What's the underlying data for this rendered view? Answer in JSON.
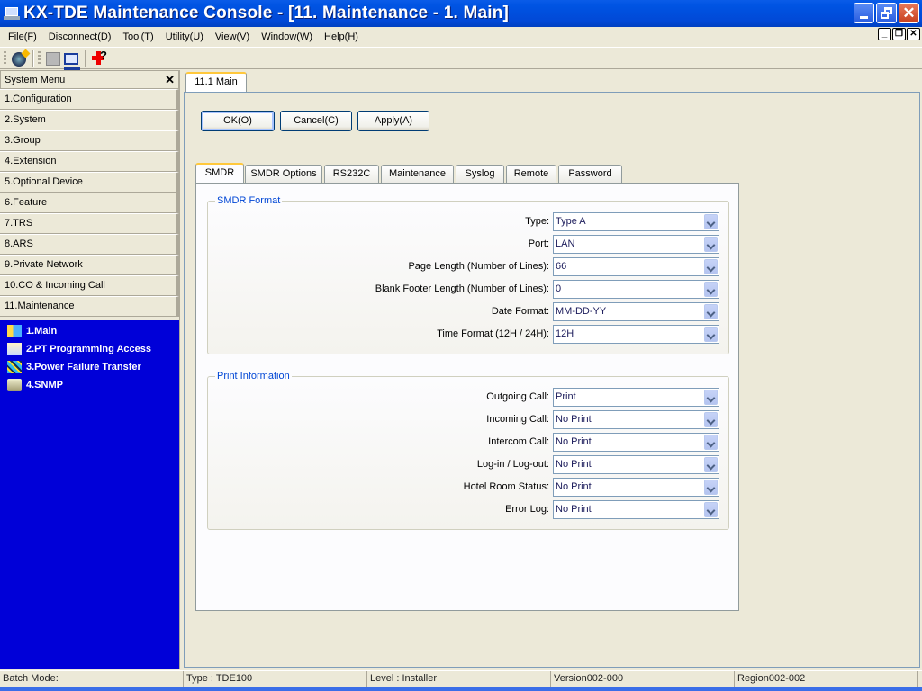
{
  "window": {
    "title": "KX-TDE Maintenance Console - [11. Maintenance - 1. Main]",
    "controls": {
      "minimize": "minimize-icon",
      "restore": "restore-icon",
      "close": "close-icon"
    }
  },
  "menubar": {
    "items": [
      "File(F)",
      "Disconnect(D)",
      "Tool(T)",
      "Utility(U)",
      "View(V)",
      "Window(W)",
      "Help(H)"
    ]
  },
  "toolbar": {
    "icons": [
      "connect-icon",
      "document-icon",
      "computer-icon",
      "help-icon"
    ]
  },
  "sidebar": {
    "title": "System Menu",
    "close_glyph": "✕",
    "categories": [
      "1.Configuration",
      "2.System",
      "3.Group",
      "4.Extension",
      "5.Optional Device",
      "6.Feature",
      "7.TRS",
      "8.ARS",
      "9.Private Network",
      "10.CO & Incoming Call",
      "11.Maintenance"
    ],
    "sub_items": [
      {
        "label": "1.Main",
        "icon": "main-icon"
      },
      {
        "label": "2.PT Programming Access",
        "icon": "pt-access-icon"
      },
      {
        "label": "3.Power Failure Transfer",
        "icon": "power-failure-icon"
      },
      {
        "label": "4.SNMP",
        "icon": "folder-icon"
      }
    ]
  },
  "document_tab": "11.1 Main",
  "buttons": {
    "ok": "OK(O)",
    "cancel": "Cancel(C)",
    "apply": "Apply(A)"
  },
  "tabs": [
    "SMDR",
    "SMDR Options",
    "RS232C",
    "Maintenance",
    "Syslog",
    "Remote",
    "Password"
  ],
  "active_tab": "SMDR",
  "smdr_format": {
    "title": "SMDR Format",
    "fields": [
      {
        "label": "Type:",
        "value": "Type A"
      },
      {
        "label": "Port:",
        "value": "LAN"
      },
      {
        "label": "Page Length (Number of Lines):",
        "value": "66"
      },
      {
        "label": "Blank Footer Length (Number of Lines):",
        "value": "0"
      },
      {
        "label": "Date Format:",
        "value": "MM-DD-YY"
      },
      {
        "label": "Time Format (12H / 24H):",
        "value": "12H"
      }
    ]
  },
  "print_information": {
    "title": "Print Information",
    "fields": [
      {
        "label": "Outgoing Call:",
        "value": "Print"
      },
      {
        "label": "Incoming Call:",
        "value": "No Print"
      },
      {
        "label": "Intercom Call:",
        "value": "No Print"
      },
      {
        "label": "Log-in / Log-out:",
        "value": "No Print"
      },
      {
        "label": "Hotel Room Status:",
        "value": "No Print"
      },
      {
        "label": "Error Log:",
        "value": "No Print"
      }
    ]
  },
  "statusbar": {
    "batch_mode": "Batch Mode:",
    "type": "Type : TDE100",
    "level": "Level : Installer",
    "version": "Version002-000",
    "region": "Region002-002"
  }
}
